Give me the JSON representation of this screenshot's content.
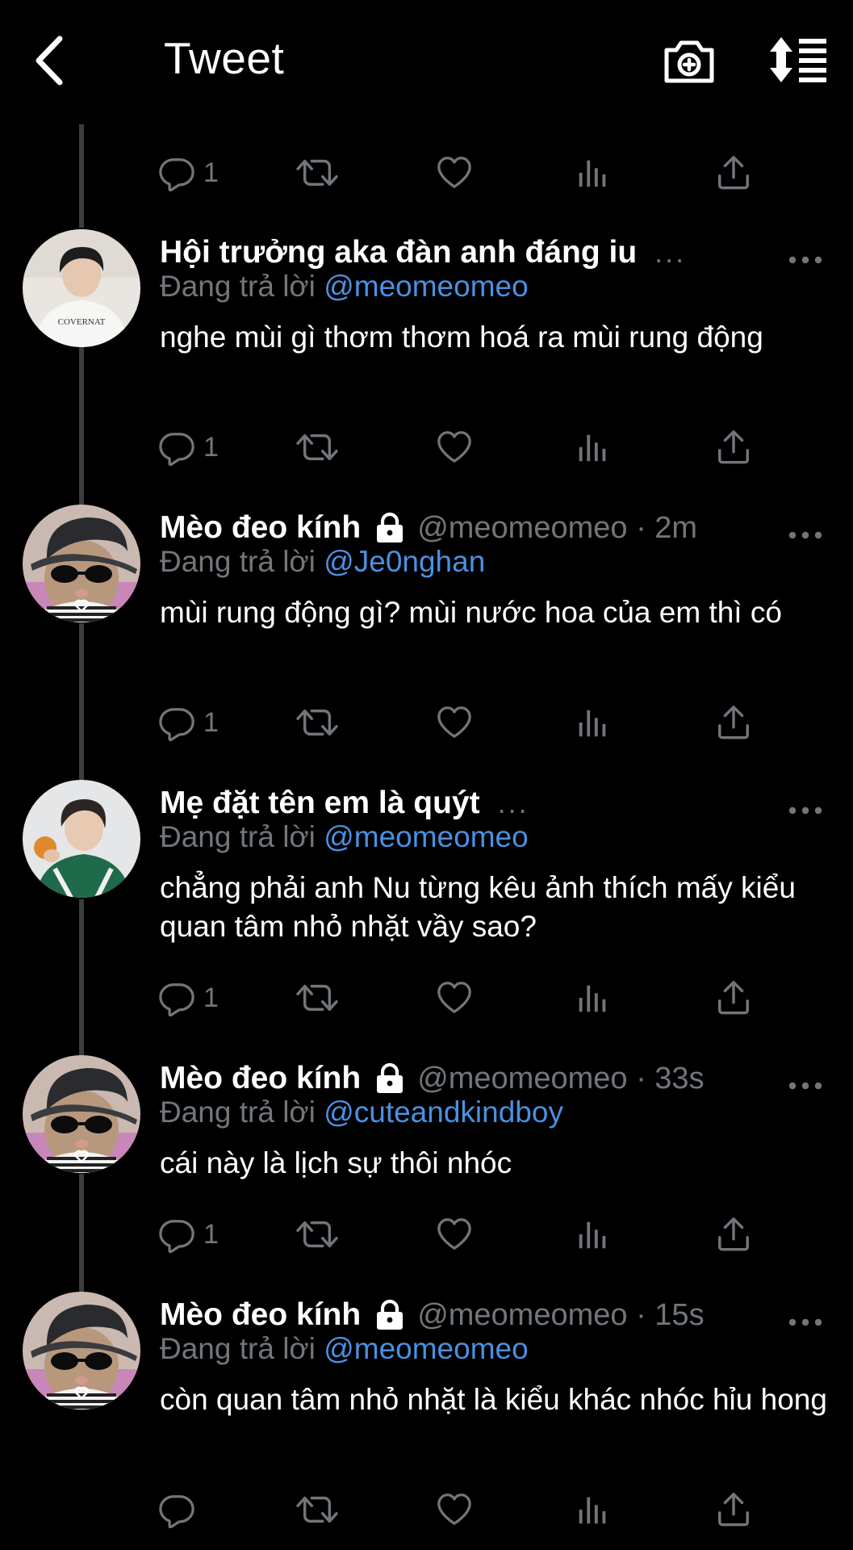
{
  "header": {
    "title": "Tweet",
    "back_icon": "chevron-left-icon",
    "camera_icon": "camera-plus-icon",
    "sort_icon": "sort-list-icon"
  },
  "colors": {
    "background": "#000000",
    "text": "#ffffff",
    "secondary": "#71767b",
    "mention": "#4a90e2",
    "thread_line": "#3a3d40"
  },
  "top_actions": {
    "reply_count": "1"
  },
  "tweets": [
    {
      "name": "Hội trưởng aka đàn anh đáng iu",
      "truncated": "...",
      "replying_label": "Đang trả lời",
      "replying_to": "@meomeomeo",
      "text": "nghe mùi gì thơm thơm hoá ra mùi rung động",
      "reply_count": "1",
      "avatar": "avatar-boy-white-shirt"
    },
    {
      "name": "Mèo đeo kính",
      "handle": "@meomeomeo · 2m",
      "replying_label": "Đang trả lời",
      "replying_to": "@Je0nghan",
      "text": "mùi rung động gì? mùi nước hoa của em thì có",
      "reply_count": "1",
      "avatar": "avatar-cat-sunglasses"
    },
    {
      "name": "Mẹ đặt tên em là quýt",
      "truncated": "...",
      "replying_label": "Đang trả lời",
      "replying_to": "@meomeomeo",
      "text": "chẳng phải anh Nu từng kêu ảnh thích mấy kiểu quan tâm nhỏ nhặt vầy sao?",
      "reply_count": "1",
      "avatar": "avatar-boy-orange"
    },
    {
      "name": "Mèo đeo kính",
      "handle": "@meomeomeo · 33s",
      "replying_label": "Đang trả lời",
      "replying_to": "@cuteandkindboy",
      "text": "cái này là lịch sự thôi nhóc",
      "reply_count": "1",
      "avatar": "avatar-cat-sunglasses"
    },
    {
      "name": "Mèo đeo kính",
      "handle": "@meomeomeo · 15s",
      "replying_label": "Đang trả lời",
      "replying_to": "@meomeomeo",
      "text": "còn quan tâm nhỏ nhặt là kiểu khác nhóc hỉu hong",
      "reply_count": "",
      "avatar": "avatar-cat-sunglasses"
    }
  ]
}
